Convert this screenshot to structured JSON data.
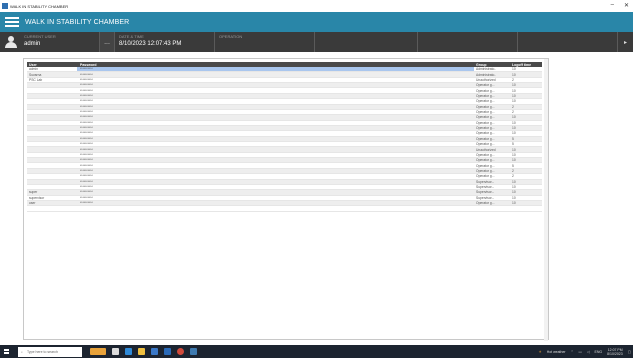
{
  "window": {
    "title": "WALK IN STABILITY CHAMBER",
    "controls": [
      "–",
      "✕"
    ]
  },
  "appbar": {
    "title": "WALK IN STABILITY CHAMBER"
  },
  "infobar": {
    "user_label": "CURRENT USER",
    "user_value": "admin",
    "dots": "...",
    "datetime_label": "DATE & TIME",
    "datetime_value": "8/10/2023 12:07:43 PM",
    "operation_label": "OPERATION",
    "arrow": "▸"
  },
  "grid": {
    "columns": [
      "User",
      "Password",
      "Group",
      "Logoff time"
    ],
    "rows": [
      {
        "user": "admin",
        "password": "**********",
        "group": "Administrato..",
        "time": "10"
      },
      {
        "user": "Suvarna",
        "password": "**********",
        "group": "Administrato..",
        "time": "10"
      },
      {
        "user": "PSC Lab",
        "password": "**********",
        "group": "Unauthorized",
        "time": "2"
      },
      {
        "user": "",
        "password": "**********",
        "group": "Operator g...",
        "time": "10"
      },
      {
        "user": "",
        "password": "**********",
        "group": "Operator g...",
        "time": "10"
      },
      {
        "user": "",
        "password": "**********",
        "group": "Operator g...",
        "time": "10"
      },
      {
        "user": "",
        "password": "**********",
        "group": "Operator g...",
        "time": "10"
      },
      {
        "user": "",
        "password": "**********",
        "group": "Operator g...",
        "time": "2"
      },
      {
        "user": "",
        "password": "**********",
        "group": "Operator g...",
        "time": "2"
      },
      {
        "user": "",
        "password": "**********",
        "group": "Operator g...",
        "time": "10"
      },
      {
        "user": "",
        "password": "**********",
        "group": "Operator g...",
        "time": "10"
      },
      {
        "user": "",
        "password": "**********",
        "group": "Operator g...",
        "time": "10"
      },
      {
        "user": "",
        "password": "**********",
        "group": "Operator g...",
        "time": "10"
      },
      {
        "user": "",
        "password": "**********",
        "group": "Operator g...",
        "time": "5"
      },
      {
        "user": "",
        "password": "**********",
        "group": "Operator g...",
        "time": "5"
      },
      {
        "user": "",
        "password": "**********",
        "group": "Unauthorized",
        "time": "10"
      },
      {
        "user": "",
        "password": "**********",
        "group": "Operator g...",
        "time": "10"
      },
      {
        "user": "",
        "password": "**********",
        "group": "Operator g...",
        "time": "10"
      },
      {
        "user": "",
        "password": "**********",
        "group": "Operator g...",
        "time": "5"
      },
      {
        "user": "",
        "password": "**********",
        "group": "Operator g...",
        "time": "2"
      },
      {
        "user": "",
        "password": "**********",
        "group": "Operator g...",
        "time": "2"
      },
      {
        "user": "",
        "password": "**********",
        "group": "Supervisor...",
        "time": "10"
      },
      {
        "user": "",
        "password": "**********",
        "group": "Supervisor...",
        "time": "10"
      },
      {
        "user": "super",
        "password": "**********",
        "group": "Supervisor...",
        "time": "10"
      },
      {
        "user": "supervisor",
        "password": "**********",
        "group": "Supervisor...",
        "time": "10"
      },
      {
        "user": "user",
        "password": "**********",
        "group": "Operator g...",
        "time": "10"
      },
      {
        "user": "",
        "password": "",
        "group": "",
        "time": ""
      }
    ]
  },
  "taskbar": {
    "search_placeholder": "Type here to search",
    "tray_text": "Hot weather",
    "lang": "ENG",
    "time": "12:07 PM",
    "date": "8/10/2023"
  }
}
